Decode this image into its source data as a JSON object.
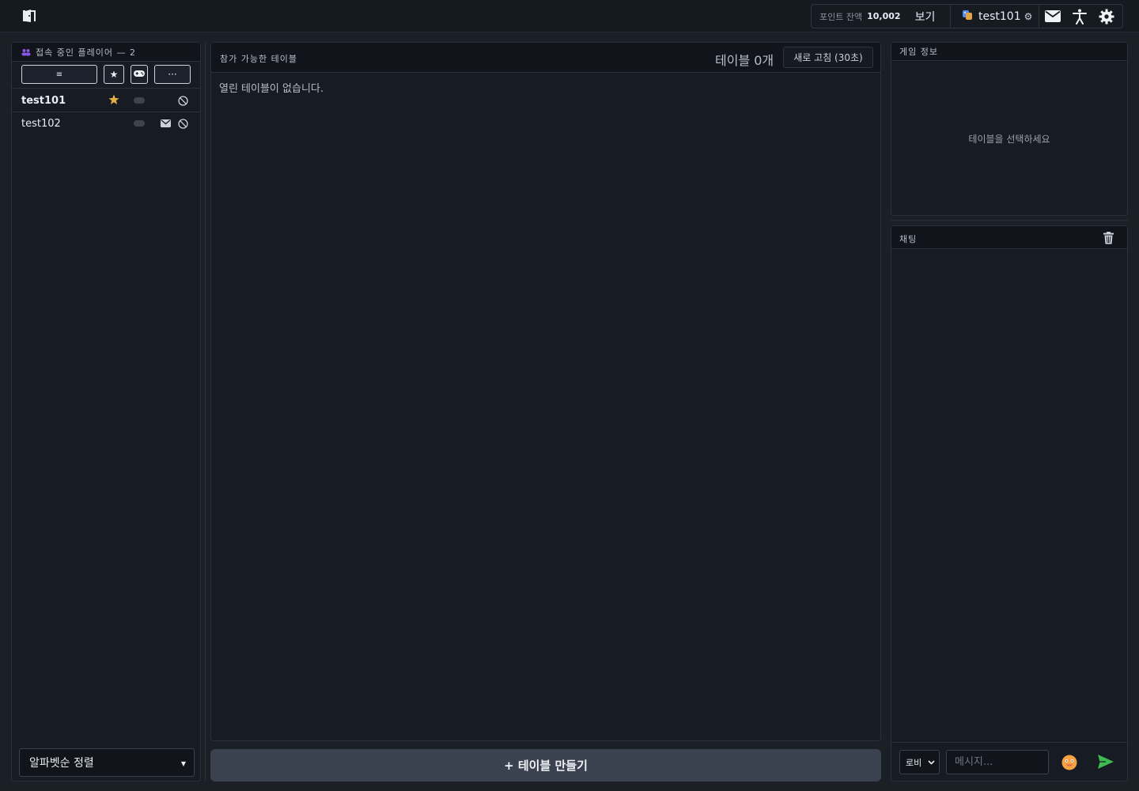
{
  "topbar": {
    "logo_icon": "door-icon",
    "points_label": "포인트 잔액",
    "points_value": "10,002",
    "view_label": "보기",
    "username": "test101",
    "user_gear": "⚙",
    "icons": [
      "mail-icon",
      "accessibility-icon",
      "gear-icon"
    ]
  },
  "players": {
    "title": "접속 중인 플레이어 — 2",
    "filters": [
      {
        "label": "≡",
        "icon": "list-icon"
      },
      {
        "label": "★",
        "icon": "star-icon"
      },
      {
        "label": "",
        "icon": "gamepad-icon"
      },
      {
        "label": "···",
        "icon": "more-icon"
      }
    ],
    "list": [
      {
        "name": "test101",
        "favorite": true
      },
      {
        "name": "test102",
        "favorite": false
      }
    ],
    "sort_label": "알파벳순 정렬"
  },
  "tables": {
    "title": "참가 가능한 테이블",
    "count": "테이블 0개",
    "refresh": "새로 고침 (30초)",
    "empty": "열린 테이블이 없습니다.",
    "create": "+ 테이블 만들기"
  },
  "info": {
    "title": "게임 정보",
    "empty": "테이블을 선택하세요"
  },
  "chat": {
    "title": "채팅",
    "channel": "로비",
    "placeholder": "메시지...",
    "colors": {
      "send": "#3fb950",
      "accent_purple": "#8957e5",
      "star": "#e3b341"
    }
  }
}
